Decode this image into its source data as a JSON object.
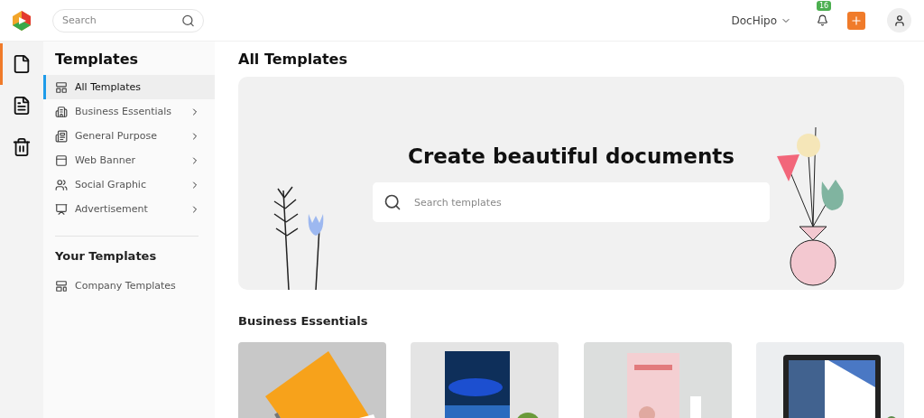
{
  "topbar": {
    "search": {
      "placeholder": "Search"
    },
    "account": "DocHipo",
    "notifications": "16"
  },
  "rail": [
    {
      "selected": true
    },
    {
      "selected": false
    },
    {
      "selected": false
    }
  ],
  "sidebar": {
    "title": "Templates",
    "items": [
      {
        "label": "All Templates",
        "selected": true,
        "expandable": false
      },
      {
        "label": "Business Essentials",
        "selected": false,
        "expandable": true
      },
      {
        "label": "General Purpose",
        "selected": false,
        "expandable": true
      },
      {
        "label": "Web Banner",
        "selected": false,
        "expandable": true
      },
      {
        "label": "Social Graphic",
        "selected": false,
        "expandable": true
      },
      {
        "label": "Advertisement",
        "selected": false,
        "expandable": true
      }
    ],
    "your_title": "Your Templates",
    "your_items": [
      {
        "label": "Company Templates"
      }
    ]
  },
  "main": {
    "title": "All Templates",
    "banner": {
      "heading": "Create beautiful documents",
      "search": {
        "placeholder": "Search templates"
      }
    },
    "section": "Business Essentials"
  }
}
